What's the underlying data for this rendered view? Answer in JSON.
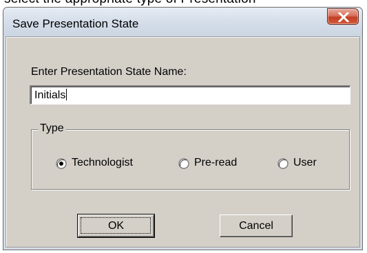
{
  "background_text": "select the appropriate type of Presentation",
  "window": {
    "title": "Save Presentation State"
  },
  "dialog": {
    "prompt_label": "Enter Presentation State Name:",
    "name_input": {
      "value": "Initials",
      "placeholder": ""
    },
    "type_group": {
      "legend": "Type",
      "options": [
        {
          "label": "Technologist",
          "selected": true
        },
        {
          "label": "Pre-read",
          "selected": false
        },
        {
          "label": "User",
          "selected": false
        }
      ]
    },
    "buttons": {
      "ok_label": "OK",
      "cancel_label": "Cancel"
    }
  },
  "icons": {
    "close": "close-icon",
    "radio_selected": "radio-selected-icon",
    "radio_unselected": "radio-unselected-icon"
  },
  "colors": {
    "dialog_face": "#d4d0c8",
    "titlebar": "#d6dfea",
    "close_button": "#c94a2e"
  }
}
